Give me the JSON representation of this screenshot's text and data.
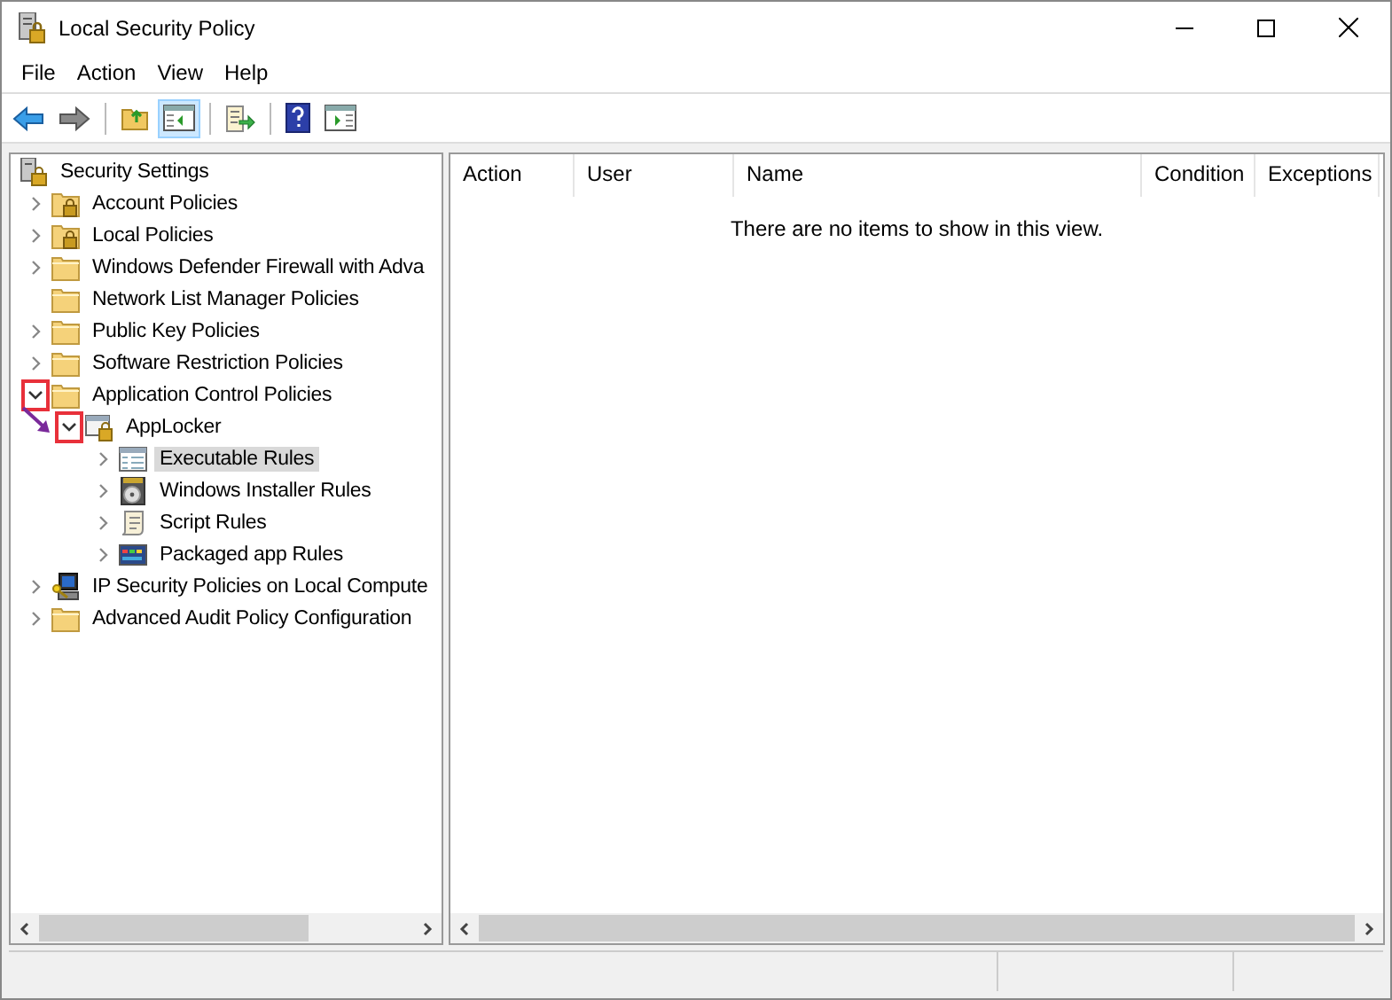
{
  "window": {
    "title": "Local Security Policy"
  },
  "menu": [
    "File",
    "Action",
    "View",
    "Help"
  ],
  "toolbar": [
    {
      "selected": false
    },
    {
      "selected": false
    },
    {
      "selected": false
    },
    {
      "selected": true
    },
    {
      "selected": false
    },
    {
      "selected": false
    },
    {
      "selected": false
    }
  ],
  "tree": [
    {
      "label": "Security Settings",
      "kind": "shield",
      "selected": false,
      "children": [
        {
          "label": "Account Policies",
          "kind": "lockfolder",
          "expanded": false,
          "selected": false
        },
        {
          "label": "Local Policies",
          "kind": "lockfolder",
          "expanded": false,
          "selected": false
        },
        {
          "label": "Windows Defender Firewall with Adva",
          "kind": "folder",
          "expanded": false,
          "selected": false
        },
        {
          "label": "Network List Manager Policies",
          "kind": "folder",
          "selected": false
        },
        {
          "label": "Public Key Policies",
          "kind": "folder",
          "expanded": false,
          "selected": false
        },
        {
          "label": "Software Restriction Policies",
          "kind": "folder",
          "expanded": false,
          "selected": false
        },
        {
          "label": "Application Control Policies",
          "kind": "folder",
          "expanded": true,
          "highlighted": true,
          "selected": false,
          "children": [
            {
              "label": "AppLocker",
              "kind": "applocker",
              "expanded": true,
              "highlighted": true,
              "selected": false,
              "children": [
                {
                  "label": "Executable Rules",
                  "kind": "rules",
                  "expanded": false,
                  "selected": true
                },
                {
                  "label": "Windows Installer Rules",
                  "kind": "installer",
                  "expanded": false,
                  "selected": false
                },
                {
                  "label": "Script Rules",
                  "kind": "script",
                  "expanded": false,
                  "selected": false
                },
                {
                  "label": "Packaged app Rules",
                  "kind": "packaged",
                  "expanded": false,
                  "selected": false
                }
              ]
            }
          ]
        },
        {
          "label": "IP Security Policies on Local Compute",
          "kind": "ipsec",
          "expanded": false,
          "selected": false
        },
        {
          "label": "Advanced Audit Policy Configuration",
          "kind": "folder",
          "expanded": false,
          "selected": false
        }
      ]
    }
  ],
  "list": {
    "columns": [
      "Action",
      "User",
      "Name",
      "Condition",
      "Exceptions"
    ],
    "empty_message": "There are no items to show in this view."
  }
}
